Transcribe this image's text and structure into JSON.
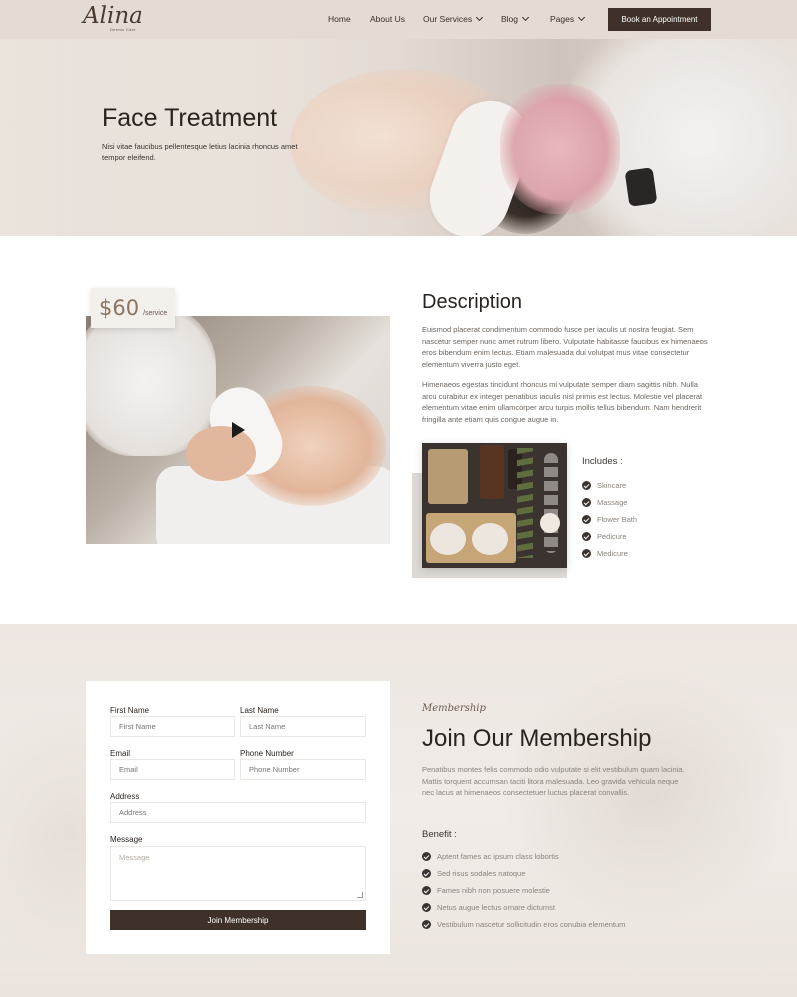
{
  "nav": {
    "logo": "Alina",
    "logo_sub": "Dermis Care",
    "items": [
      {
        "label": "Home"
      },
      {
        "label": "About Us"
      },
      {
        "label": "Our Services"
      },
      {
        "label": "Blog"
      },
      {
        "label": "Pages"
      }
    ],
    "cta": "Book an Appointment"
  },
  "hero": {
    "title": "Face Treatment",
    "text": "Nisi vitae faucibus pellentesque letius lacinia rhoncus amet tempor eleifend."
  },
  "service": {
    "price": "$60",
    "price_unit": "/service",
    "desc_title": "Description",
    "desc_p1": "Euismod placerat condimentum commodo fusce per iaculis ut nostra feugiat. Sem nascetur semper nunc amet rutrum libero. Vulputate habitasse faucibus ex himenaeos eros bibendum enim lectus. Etiam malesuada dui volutpat mus vitae consectetur elementum viverra justo eget.",
    "desc_p2": "Himenaeos egestas tincidunt rhoncus mi vulputate semper diam sagittis nibh. Nulla arcu curabitur ex integer penatibus iaculis nisl primis est lectus. Molestie vel placerat elementum vitae enim ullamcorper arcu turpis mollis tellus bibendum. Nam hendrerit fringilla ante etiam quis congue augue in.",
    "includes_title": "Includes :",
    "includes": [
      "Skincare",
      "Massage",
      "Flower Bath",
      "Pedicure",
      "Medicure"
    ]
  },
  "form": {
    "first_name_label": "First Name",
    "first_name_placeholder": "First Name",
    "last_name_label": "Last Name",
    "last_name_placeholder": "Last Name",
    "email_label": "Email",
    "email_placeholder": "Email",
    "phone_label": "Phone Number",
    "phone_placeholder": "Phone Number",
    "address_label": "Address",
    "address_placeholder": "Address",
    "message_label": "Message",
    "message_placeholder": "Message",
    "submit": "Join Membership"
  },
  "membership": {
    "tag": "Membership",
    "title": "Join Our Membership",
    "text": "Penatibus montes felis commodo odio vulputate si elit vestibulum quam lacinia. Mattis torquent accumsan taciti litora malesuada. Leo gravida vehicula neque nec lacus at himenaeos consectetuer luctus placerat convallis.",
    "benefit_title": "Benefit :",
    "benefits": [
      "Aptent fames ac ipsum class lobortis",
      "Sed risus sodales natoque",
      "Fames nibh non posuere molestie",
      "Netus augue lectus ornare dictumst",
      "Vestibulum nascetur sollicitudin eros conubia elementum"
    ]
  },
  "colors": {
    "accent_dark": "#3f3129",
    "price_brown": "#8a7563",
    "nav_bg": "#e3dbd4",
    "section_bg": "#ede6e1"
  },
  "icons": [
    "chevron-down-icon",
    "play-icon",
    "check-circle-icon"
  ]
}
